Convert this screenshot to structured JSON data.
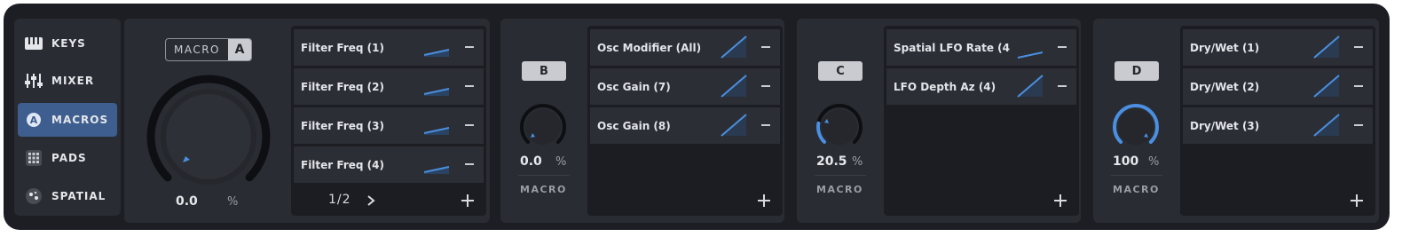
{
  "sidebar": {
    "items": [
      {
        "label": "KEYS",
        "icon": "piano-keys-icon",
        "active": false
      },
      {
        "label": "MIXER",
        "icon": "mixer-sliders-icon",
        "active": false
      },
      {
        "label": "MACROS",
        "icon": "macros-a-icon",
        "active": true
      },
      {
        "label": "PADS",
        "icon": "pads-grid-icon",
        "active": false
      },
      {
        "label": "SPATIAL",
        "icon": "spatial-dots-icon",
        "active": false
      }
    ]
  },
  "macro_a": {
    "title_left": "MACRO",
    "title_letter": "A",
    "value": "0.0",
    "unit": "%",
    "knob_level": 0.0,
    "pager": "1/2",
    "rows": [
      {
        "label": "Filter Freq (1)"
      },
      {
        "label": "Filter Freq (2)"
      },
      {
        "label": "Filter Freq (3)"
      },
      {
        "label": "Filter Freq (4)"
      }
    ]
  },
  "macro_b": {
    "letter": "B",
    "value": "0.0",
    "unit": "%",
    "caption": "MACRO",
    "knob_level": 0.0,
    "rows": [
      {
        "label": "Osc Modifier (All)"
      },
      {
        "label": "Osc Gain (7)"
      },
      {
        "label": "Osc Gain (8)"
      }
    ]
  },
  "macro_c": {
    "letter": "C",
    "value": "20.5",
    "unit": "%",
    "caption": "MACRO",
    "knob_level": 0.205,
    "rows": [
      {
        "label": "Spatial LFO Rate (4"
      },
      {
        "label": "LFO Depth Az (4)"
      }
    ]
  },
  "macro_d": {
    "letter": "D",
    "value": "100",
    "unit": "%",
    "caption": "MACRO",
    "knob_level": 1.0,
    "rows": [
      {
        "label": "Dry/Wet (1)"
      },
      {
        "label": "Dry/Wet (2)"
      },
      {
        "label": "Dry/Wet (3)"
      }
    ]
  },
  "colors": {
    "accent": "#4a8fe0",
    "panel": "#2a2c33",
    "background": "#1d1e23"
  }
}
